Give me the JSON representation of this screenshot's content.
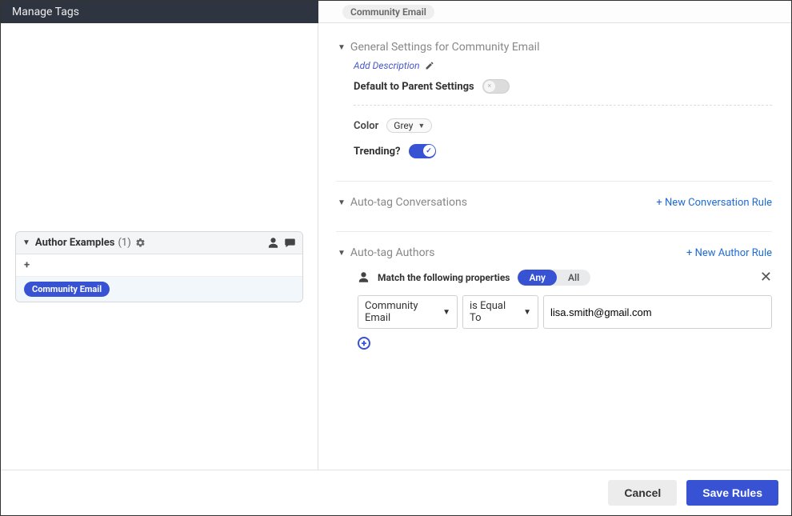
{
  "header": {
    "sidebar_title": "Manage Tags",
    "tag_chip": "Community Email"
  },
  "sidebar": {
    "group": {
      "title": "Author Examples",
      "count": "(1)"
    },
    "add_label": "+",
    "items": [
      {
        "name": "Community Email"
      }
    ]
  },
  "main": {
    "general": {
      "title": "General Settings for Community Email",
      "add_description": "Add Description",
      "default_parent_label": "Default to Parent Settings",
      "default_parent_on": false,
      "color_label": "Color",
      "color_value": "Grey",
      "trending_label": "Trending?",
      "trending_on": true
    },
    "auto_conversations": {
      "title": "Auto-tag Conversations",
      "new_rule_link": "+ New Conversation Rule"
    },
    "auto_authors": {
      "title": "Auto-tag Authors",
      "new_rule_link": "+ New Author Rule",
      "match_label": "Match the following properties",
      "match_mode": "Any",
      "segments": {
        "any": "Any",
        "all": "All"
      },
      "condition": {
        "field": "Community Email",
        "operator": "is Equal To",
        "value": "lisa.smith@gmail.com"
      }
    }
  },
  "footer": {
    "cancel": "Cancel",
    "save": "Save Rules"
  }
}
